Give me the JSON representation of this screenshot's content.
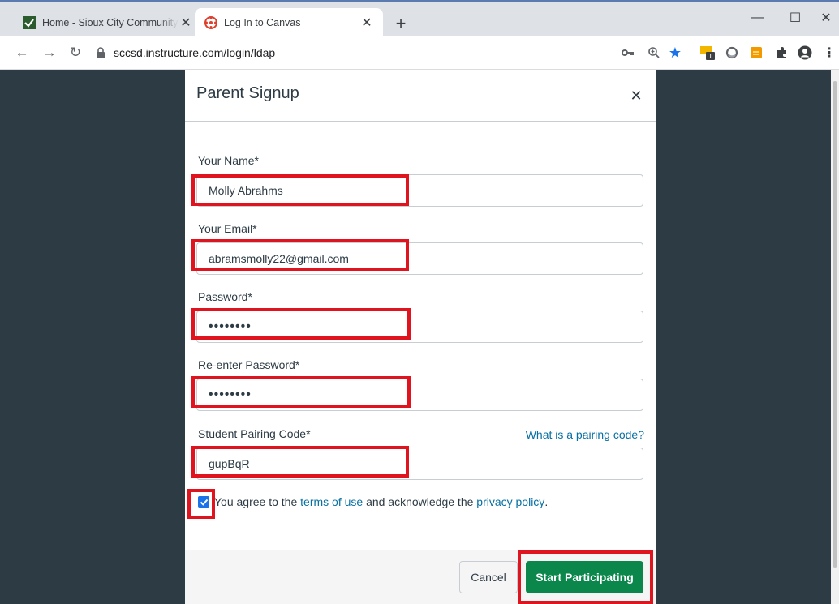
{
  "browser": {
    "tabs": [
      {
        "title": "Home - Sioux City Community Sc",
        "active": false
      },
      {
        "title": "Log In to Canvas",
        "active": true
      }
    ],
    "address": "sccsd.instructure.com/login/ldap"
  },
  "modal": {
    "title": "Parent Signup",
    "fields": {
      "name": {
        "label": "Your Name*",
        "value": "Molly Abrahms"
      },
      "email": {
        "label": "Your Email*",
        "value": "abramsmolly22@gmail.com"
      },
      "password": {
        "label": "Password*",
        "value": "••••••••"
      },
      "confirm": {
        "label": "Re-enter Password*",
        "value": "••••••••"
      },
      "pairing": {
        "label": "Student Pairing Code*",
        "value": "gupBqR",
        "help": "What is a pairing code?"
      }
    },
    "agree": {
      "prefix": "You agree to the",
      "terms": "terms of use",
      "middle": "and acknowledge the",
      "privacy": "privacy policy",
      "suffix": ".",
      "checked": true
    },
    "footer": {
      "cancel": "Cancel",
      "submit": "Start Participating"
    }
  },
  "colors": {
    "accent_green": "#0b874b",
    "highlight_red": "#e0141e",
    "link_blue": "#0770a3"
  }
}
